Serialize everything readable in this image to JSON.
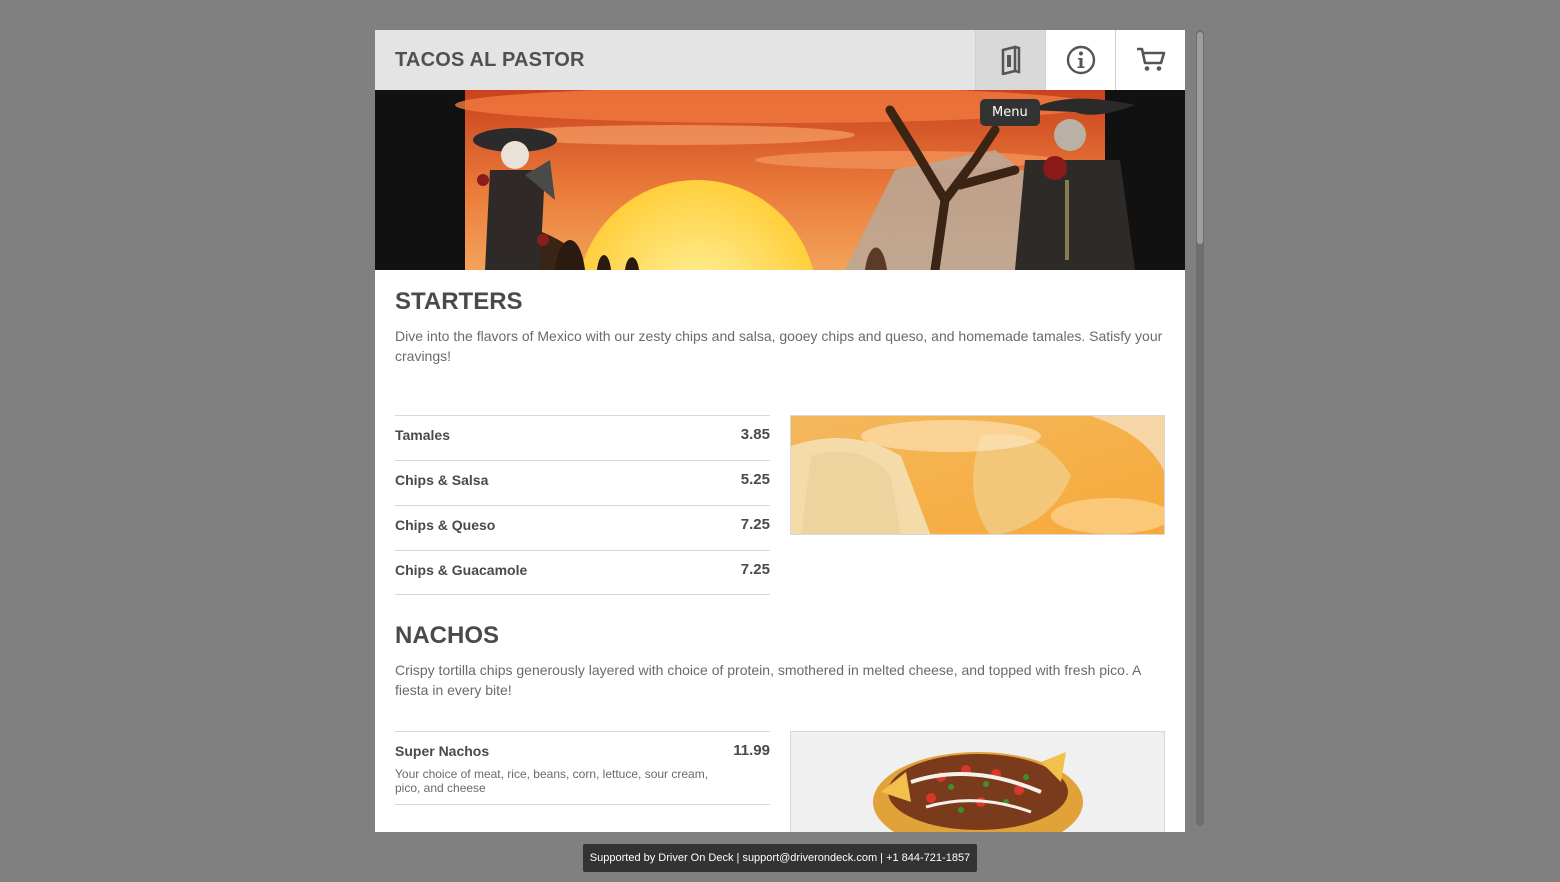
{
  "header": {
    "title": "TACOS AL PASTOR",
    "buttons": [
      {
        "icon": "menu-book-icon",
        "tooltip": "Menu"
      },
      {
        "icon": "info-icon"
      },
      {
        "icon": "cart-icon"
      }
    ]
  },
  "tooltip": {
    "label": "Menu"
  },
  "sections": [
    {
      "title": "STARTERS",
      "description": "Dive into the flavors of Mexico with our zesty chips and salsa, gooey chips and queso, and homemade tamales. Satisfy your cravings!",
      "items": [
        {
          "name": "Tamales",
          "price": "3.85"
        },
        {
          "name": "Chips & Salsa",
          "price": "5.25"
        },
        {
          "name": "Chips & Queso",
          "price": "7.25"
        },
        {
          "name": "Chips & Guacamole",
          "price": "7.25"
        }
      ]
    },
    {
      "title": "NACHOS",
      "description": "Crispy tortilla chips generously layered with choice of protein, smothered in melted cheese, and topped with fresh pico. A fiesta in every bite!",
      "items": [
        {
          "name": "Super Nachos",
          "price": "11.99",
          "description": "Your choice of meat, rice, beans, corn, lettuce, sour cream, pico, and cheese"
        }
      ]
    }
  ],
  "footer": {
    "text": "Supported by Driver On Deck | support@driverondeck.com | +1 844-721-1857"
  },
  "colors": {
    "page_background": "#808080",
    "header_background": "#e4e4e4",
    "text_dark": "#4a4a4a",
    "footer_background": "#333333",
    "banner_sky": "#e0552a",
    "banner_sun": "#ffd24a"
  }
}
